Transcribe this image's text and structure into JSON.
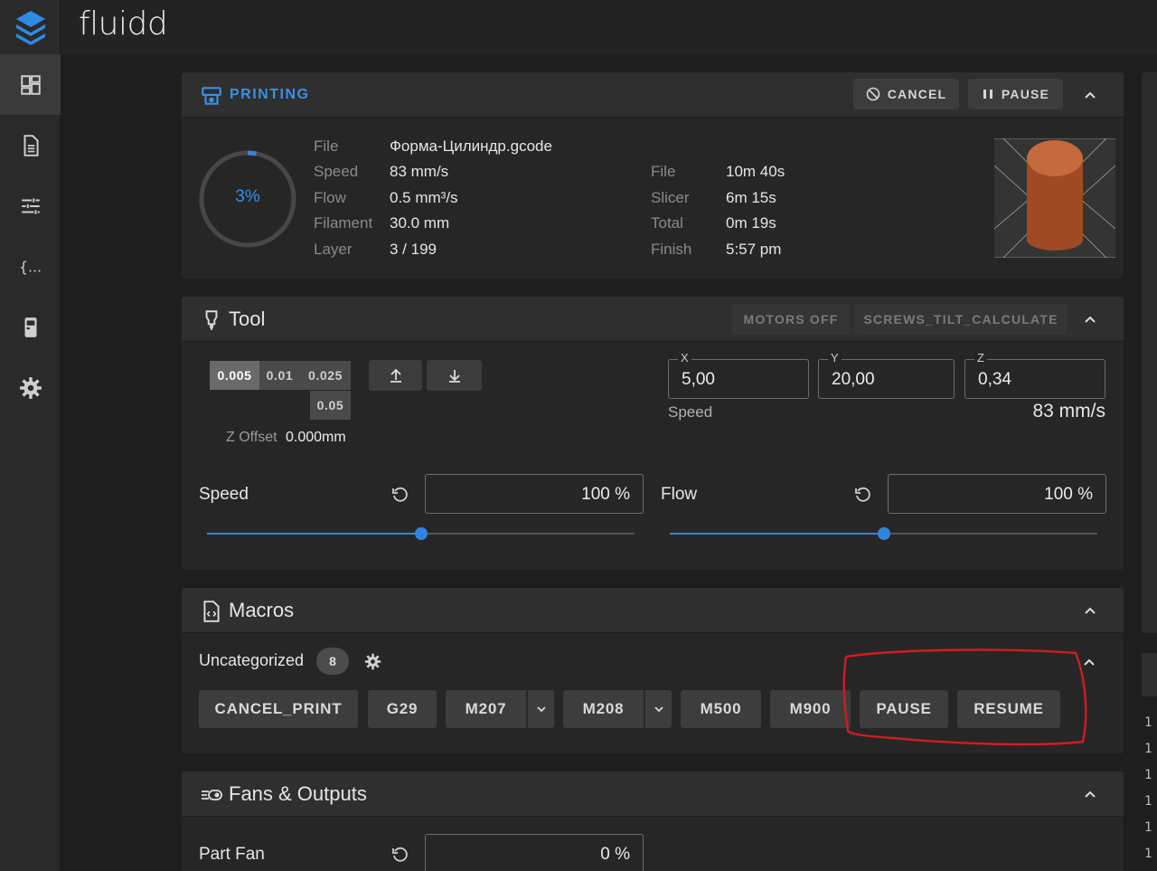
{
  "app": {
    "brand": "fluidd"
  },
  "sidebar": {
    "items": [
      {
        "name": "dashboard-icon",
        "active": true
      },
      {
        "name": "file-list-icon",
        "active": false
      },
      {
        "name": "tune-icon",
        "active": false
      },
      {
        "name": "console-icon",
        "active": false
      },
      {
        "name": "device-icon",
        "active": false
      },
      {
        "name": "settings-icon",
        "active": false
      }
    ]
  },
  "printing": {
    "title": "PRINTING",
    "cancel_label": "CANCEL",
    "pause_label": "PAUSE",
    "progress_label": "3%",
    "progress_value": 0.03,
    "left": {
      "file_label": "File",
      "file_value": "Форма-Цилиндр.gcode",
      "speed_label": "Speed",
      "speed_value": "83 mm/s",
      "flow_label": "Flow",
      "flow_value": "0.5 mm³/s",
      "filament_label": "Filament",
      "filament_value": "30.0 mm",
      "layer_label": "Layer",
      "layer_value": "3 / 199"
    },
    "right": {
      "file_label": "File",
      "file_value": "10m 40s",
      "slicer_label": "Slicer",
      "slicer_value": "6m 15s",
      "total_label": "Total",
      "total_value": "0m 19s",
      "finish_label": "Finish",
      "finish_value": "5:57 pm"
    }
  },
  "tool": {
    "title": "Tool",
    "motors_off_label": "MOTORS OFF",
    "screws_label": "SCREWS_TILT_CALCULATE",
    "steps": [
      "0.005",
      "0.01",
      "0.025",
      "0.05"
    ],
    "zoffset_label": "Z Offset",
    "zoffset_value": "0.000mm",
    "x_label": "X",
    "x_value": "5,00",
    "y_label": "Y",
    "y_value": "20,00",
    "z_label": "Z",
    "z_value": "0,34",
    "speed_caption": "Speed",
    "speed_readout": "83 mm/s",
    "speed_label": "Speed",
    "speed_value": "100 %",
    "speed_fraction": 0.5,
    "flow_label": "Flow",
    "flow_value": "100 %",
    "flow_fraction": 0.5
  },
  "macros": {
    "title": "Macros",
    "category_label": "Uncategorized",
    "category_count": "8",
    "buttons": {
      "cancel_print": "CANCEL_PRINT",
      "g29": "G29",
      "m207": "M207",
      "m208": "M208",
      "m500": "M500",
      "m900": "M900",
      "pause": "PAUSE",
      "resume": "RESUME"
    }
  },
  "fans": {
    "title": "Fans & Outputs",
    "part_fan_label": "Part Fan",
    "part_fan_value": "0 %"
  },
  "right_panel": {
    "line_numbers": [
      "1",
      "1",
      "1",
      "1",
      "1",
      "1",
      "1"
    ]
  }
}
